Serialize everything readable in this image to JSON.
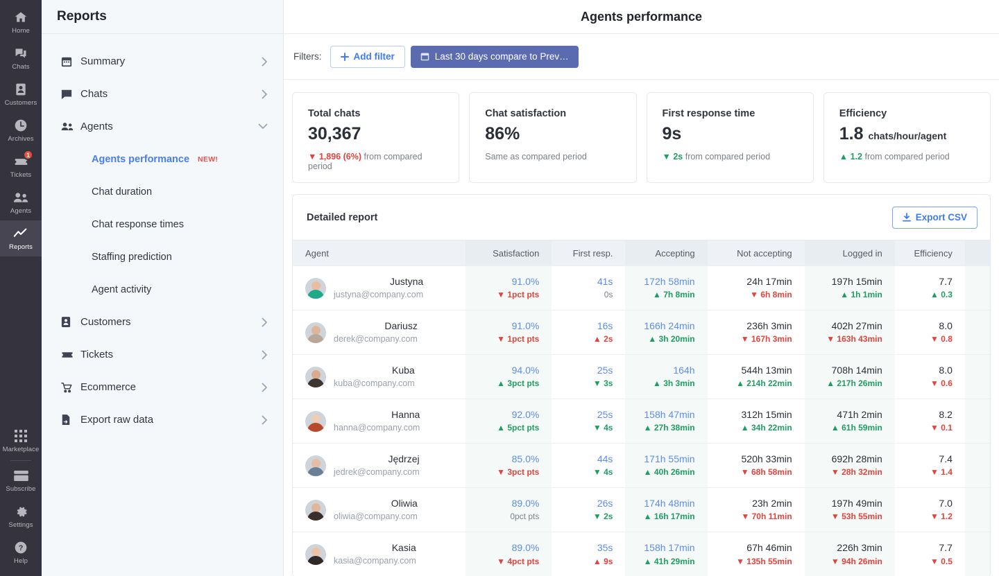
{
  "rail": {
    "items": [
      {
        "label": "Home",
        "icon": "home-icon",
        "active": false
      },
      {
        "label": "Chats",
        "icon": "chats-icon",
        "active": false
      },
      {
        "label": "Customers",
        "icon": "customers-icon",
        "active": false
      },
      {
        "label": "Archives",
        "icon": "archives-clock-icon",
        "active": false
      },
      {
        "label": "Tickets",
        "icon": "ticket-icon",
        "active": false,
        "badge": "1"
      },
      {
        "label": "Agents",
        "icon": "agents-icon",
        "active": false
      },
      {
        "label": "Reports",
        "icon": "reports-chart-icon",
        "active": true
      }
    ],
    "bottom": [
      {
        "label": "Marketplace",
        "icon": "marketplace-grid-icon"
      },
      {
        "label": "Subscribe",
        "icon": "subscribe-card-icon"
      },
      {
        "label": "Settings",
        "icon": "gear-icon"
      },
      {
        "label": "Help",
        "icon": "help-question-icon"
      }
    ]
  },
  "sidebar": {
    "title": "Reports",
    "items": [
      {
        "label": "Summary",
        "icon": "calendar-icon",
        "expanded": false
      },
      {
        "label": "Chats",
        "icon": "chat-bubble-icon",
        "expanded": false
      },
      {
        "label": "Agents",
        "icon": "agents-icon",
        "expanded": true
      }
    ],
    "sub_items": [
      {
        "label": "Agents performance",
        "selected": true,
        "tag": "NEW!"
      },
      {
        "label": "Chat duration",
        "selected": false,
        "tag": ""
      },
      {
        "label": "Chat response times",
        "selected": false,
        "tag": ""
      },
      {
        "label": "Staffing prediction",
        "selected": false,
        "tag": ""
      },
      {
        "label": "Agent activity",
        "selected": false,
        "tag": ""
      }
    ],
    "items2": [
      {
        "label": "Customers",
        "icon": "contact-card-icon"
      },
      {
        "label": "Tickets",
        "icon": "ticket-icon"
      },
      {
        "label": "Ecommerce",
        "icon": "cart-icon"
      },
      {
        "label": "Export raw data",
        "icon": "file-export-icon"
      }
    ]
  },
  "header": {
    "title": "Agents performance"
  },
  "filters": {
    "label": "Filters:",
    "add_filter": "Add filter",
    "date_range": "Last 30 days compare to Prev…"
  },
  "kpis": [
    {
      "label": "Total chats",
      "value": "30,367",
      "unit": "",
      "delta": "1,896 (6%)",
      "delta_dir": "down",
      "delta_suffix": "from compared period"
    },
    {
      "label": "Chat satisfaction",
      "value": "86%",
      "unit": "",
      "delta": "",
      "delta_dir": "neutral",
      "delta_suffix": "Same as compared period"
    },
    {
      "label": "First response time",
      "value": "9s",
      "unit": "",
      "delta": "2s",
      "delta_dir": "up",
      "delta_suffix": "from compared period"
    },
    {
      "label": "Efficiency",
      "value": "1.8",
      "unit": "chats/hour/agent",
      "delta": "1.2",
      "delta_dir": "up-green",
      "delta_suffix": "from compared period"
    }
  ],
  "report": {
    "title": "Detailed report",
    "export_label": "Export CSV",
    "columns": [
      "Agent",
      "Satisfaction",
      "First resp.",
      "Accepting",
      "Not accepting",
      "Logged in",
      "Efficiency",
      ""
    ],
    "rows": [
      {
        "name": "Justyna",
        "email": "justyna@company.com",
        "avatar": {
          "hair": "#1fa98b",
          "skin": "#e8bda2"
        },
        "cells": [
          {
            "main": "91.0%",
            "link": true,
            "sub": "1pct pts",
            "dir": "down"
          },
          {
            "main": "41s",
            "link": true,
            "sub": "0s",
            "dir": "flat"
          },
          {
            "main": "172h 58min",
            "link": true,
            "sub": "7h 8min",
            "dir": "up"
          },
          {
            "main": "24h 17min",
            "link": false,
            "sub": "6h 8min",
            "dir": "down"
          },
          {
            "main": "197h 15min",
            "link": false,
            "sub": "1h 1min",
            "dir": "up"
          },
          {
            "main": "7.7",
            "link": false,
            "sub": "0.3",
            "dir": "up"
          }
        ]
      },
      {
        "name": "Dariusz",
        "email": "derek@company.com",
        "avatar": {
          "hair": "#b9a89a",
          "skin": "#ddb79c"
        },
        "cells": [
          {
            "main": "91.0%",
            "link": true,
            "sub": "1pct pts",
            "dir": "down"
          },
          {
            "main": "16s",
            "link": true,
            "sub": "2s",
            "dir": "up-red"
          },
          {
            "main": "166h 24min",
            "link": true,
            "sub": "3h 20min",
            "dir": "up"
          },
          {
            "main": "236h 3min",
            "link": false,
            "sub": "167h 3min",
            "dir": "down"
          },
          {
            "main": "402h 27min",
            "link": false,
            "sub": "163h 43min",
            "dir": "down"
          },
          {
            "main": "8.0",
            "link": false,
            "sub": "0.8",
            "dir": "down"
          }
        ]
      },
      {
        "name": "Kuba",
        "email": "kuba@company.com",
        "avatar": {
          "hair": "#3c3530",
          "skin": "#d9ab8c"
        },
        "cells": [
          {
            "main": "94.0%",
            "link": true,
            "sub": "3pct pts",
            "dir": "up"
          },
          {
            "main": "25s",
            "link": true,
            "sub": "3s",
            "dir": "down-green"
          },
          {
            "main": "164h",
            "link": true,
            "sub": "3h 3min",
            "dir": "up"
          },
          {
            "main": "544h 13min",
            "link": false,
            "sub": "214h 22min",
            "dir": "up"
          },
          {
            "main": "708h 14min",
            "link": false,
            "sub": "217h 26min",
            "dir": "up"
          },
          {
            "main": "8.0",
            "link": false,
            "sub": "0.6",
            "dir": "down"
          }
        ]
      },
      {
        "name": "Hanna",
        "email": "hanna@company.com",
        "avatar": {
          "hair": "#b8492a",
          "skin": "#eccdb6"
        },
        "cells": [
          {
            "main": "92.0%",
            "link": true,
            "sub": "5pct pts",
            "dir": "up"
          },
          {
            "main": "25s",
            "link": true,
            "sub": "4s",
            "dir": "down-green"
          },
          {
            "main": "158h 47min",
            "link": true,
            "sub": "27h 38min",
            "dir": "up"
          },
          {
            "main": "312h 15min",
            "link": false,
            "sub": "34h 22min",
            "dir": "up"
          },
          {
            "main": "471h 2min",
            "link": false,
            "sub": "61h 59min",
            "dir": "up"
          },
          {
            "main": "8.2",
            "link": false,
            "sub": "0.1",
            "dir": "down"
          }
        ]
      },
      {
        "name": "Jędrzej",
        "email": "jedrek@company.com",
        "avatar": {
          "hair": "#6b7f96",
          "skin": "#e3bda5"
        },
        "cells": [
          {
            "main": "85.0%",
            "link": true,
            "sub": "3pct pts",
            "dir": "down"
          },
          {
            "main": "44s",
            "link": true,
            "sub": "4s",
            "dir": "down-green"
          },
          {
            "main": "171h 55min",
            "link": true,
            "sub": "40h 26min",
            "dir": "up"
          },
          {
            "main": "520h 33min",
            "link": false,
            "sub": "68h 58min",
            "dir": "down"
          },
          {
            "main": "692h 28min",
            "link": false,
            "sub": "28h 32min",
            "dir": "down"
          },
          {
            "main": "7.4",
            "link": false,
            "sub": "1.4",
            "dir": "down"
          }
        ]
      },
      {
        "name": "Oliwia",
        "email": "oliwia@company.com",
        "avatar": {
          "hair": "#3a2f2b",
          "skin": "#e0b69c"
        },
        "cells": [
          {
            "main": "89.0%",
            "link": true,
            "sub": "0pct pts",
            "dir": "flat"
          },
          {
            "main": "26s",
            "link": true,
            "sub": "2s",
            "dir": "down-green"
          },
          {
            "main": "174h 48min",
            "link": true,
            "sub": "16h 17min",
            "dir": "up"
          },
          {
            "main": "23h 2min",
            "link": false,
            "sub": "70h 11min",
            "dir": "down"
          },
          {
            "main": "197h 49min",
            "link": false,
            "sub": "53h 55min",
            "dir": "down"
          },
          {
            "main": "7.0",
            "link": false,
            "sub": "1.2",
            "dir": "down"
          }
        ]
      },
      {
        "name": "Kasia",
        "email": "kasia@company.com",
        "avatar": {
          "hair": "#2f2a28",
          "skin": "#e8c3a8"
        },
        "cells": [
          {
            "main": "89.0%",
            "link": true,
            "sub": "4pct pts",
            "dir": "down"
          },
          {
            "main": "35s",
            "link": true,
            "sub": "9s",
            "dir": "up-red"
          },
          {
            "main": "158h 17min",
            "link": true,
            "sub": "41h 29min",
            "dir": "up"
          },
          {
            "main": "67h 46min",
            "link": false,
            "sub": "135h 55min",
            "dir": "down"
          },
          {
            "main": "226h 3min",
            "link": false,
            "sub": "94h 26min",
            "dir": "down"
          },
          {
            "main": "7.7",
            "link": false,
            "sub": "0.5",
            "dir": "down"
          }
        ]
      }
    ]
  },
  "colors": {
    "rail_bg": "#35333d",
    "sidebar_bg": "#f4f8fb",
    "accent_blue": "#3e7bf0",
    "date_btn": "#5a6bb0",
    "up_green": "#1e9e63",
    "down_red": "#e2433c",
    "badge_red": "#e74c3c"
  }
}
